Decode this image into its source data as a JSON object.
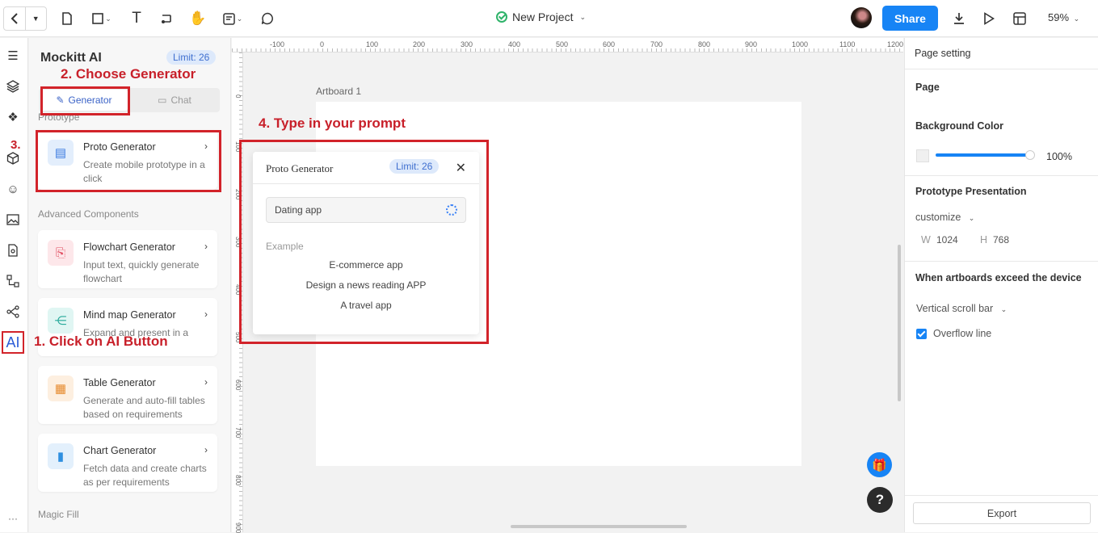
{
  "topbar": {
    "project_title": "New Project",
    "share_label": "Share",
    "zoom_level": "59%"
  },
  "left_panel": {
    "title": "Mockitt AI",
    "limit": "Limit: 26",
    "tabs": {
      "generator": "Generator",
      "chat": "Chat"
    },
    "section_prototype": "Prototype",
    "section_advanced": "Advanced Components",
    "section_magic": "Magic Fill",
    "cards": [
      {
        "title": "Proto Generator",
        "desc": "Create mobile prototype in a click"
      },
      {
        "title": "Flowchart Generator",
        "desc": "Input text, quickly generate flowchart"
      },
      {
        "title": "Mind map Generator",
        "desc": "Expand and present in a"
      },
      {
        "title": "Table Generator",
        "desc": "Generate and auto-fill tables based on requirements"
      },
      {
        "title": "Chart Generator",
        "desc": "Fetch data and create charts as per requirements"
      }
    ]
  },
  "canvas": {
    "artboard_label": "Artboard 1",
    "ruler_top": [
      "-100",
      "0",
      "100",
      "200",
      "300",
      "400",
      "500",
      "600",
      "700",
      "800",
      "900",
      "1000",
      "1100",
      "1200"
    ],
    "ruler_left": [
      "0",
      "100",
      "200",
      "300",
      "400",
      "500",
      "600",
      "700",
      "800",
      "900"
    ]
  },
  "dialog": {
    "title": "Proto Generator",
    "limit": "Limit: 26",
    "input_value": "Dating app",
    "example_label": "Example",
    "examples": [
      "E-commerce app",
      "Design a news reading APP",
      "A travel app"
    ]
  },
  "annotations": {
    "step1": "1. Click on AI Button",
    "step2": "2. Choose Generator",
    "step3": "3.",
    "step4": "4. Type in your prompt"
  },
  "right_panel": {
    "page_setting": "Page setting",
    "page": "Page",
    "background_color": "Background Color",
    "opacity": "100%",
    "prototype_presentation": "Prototype Presentation",
    "presentation_mode": "customize",
    "w_label": "W",
    "w_value": "1024",
    "h_label": "H",
    "h_value": "768",
    "exceed_heading": "When artboards exceed the device",
    "scroll_mode": "Vertical scroll bar",
    "overflow_line": "Overflow line",
    "export_label": "Export"
  },
  "colors": {
    "accent": "#1784f5",
    "annotation_red": "#d2232a",
    "success_green": "#2fb36a"
  }
}
